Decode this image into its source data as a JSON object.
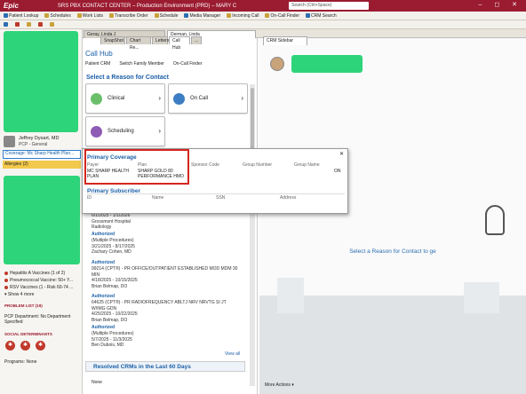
{
  "titlebar": {
    "logo": "Epic",
    "title": "SRS PBX CONTACT CENTER – Production Environment (PRD) – MARY C",
    "search_placeholder": "Search (Ctrl+Space)",
    "window_controls": "– ◻ ✕"
  },
  "toolbar": {
    "row1": [
      "Patient Lookup",
      "Schedules",
      "Work Lists",
      "Transcribe Order",
      "Schedule",
      "Media Manager",
      "Incoming Call",
      "On-Call Finder",
      "CRM Search"
    ]
  },
  "tabs": {
    "workspace": [
      "Geray, Linda J",
      "Derman, Linda"
    ],
    "activity": [
      "SnapShot",
      "Chart Re...",
      "Letters",
      "Call Hub",
      "..."
    ]
  },
  "sidebar": {
    "provider_name": "Jeffrey Dysart, MD",
    "provider_role": "PCP - General",
    "coverage": "Coverage: Mc Sharp Health Plan...",
    "allergies": "Allergies (2)",
    "vaccines": [
      "Hepatitis A Vaccines (1 of 2)",
      "Pneumococcal Vaccine: 50+ Y...",
      "RSV Vaccines (1 - Risk 60-74 ..."
    ],
    "show_more": "Show 4 more",
    "problem_list": "PROBLEM LIST (19)",
    "pcp_department": "PCP Department: No Department Specified",
    "social_determinants": "SOCIAL DETERMINANTS",
    "programs": "Programs: None"
  },
  "hub": {
    "title": "Call Hub",
    "links": [
      "Patient CRM",
      "Switch Family Member",
      "On-Call Finder"
    ],
    "select_reason": "Select a Reason for Contact",
    "reasons": [
      "Clinical",
      "On Call",
      "Scheduling"
    ],
    "auth_items": [
      {
        "lines": [
          "6/1/2025 - 1/1/2026",
          "Grossmont Hospital",
          "Radiology"
        ]
      },
      {
        "status": "Authorized",
        "lines": [
          "(Multiple Procedures)",
          "3/21/2025 - 8/17/2025",
          "Zachary Cohen, MD"
        ]
      },
      {
        "status": "Authorized",
        "lines": [
          "99214 (CPT®) - PR OFFICE/OUTPATIENT ESTABLISHED MOD MDM 30",
          "MIN",
          "4/18/2025 - 10/15/2025",
          "Brian Belmap, DO"
        ]
      },
      {
        "status": "Authorized",
        "lines": [
          "64625 (CPT®) - PR RADIOFREQUENCY ABLTJ NRV NRVTG SI JT",
          "W/IMG GDN",
          "4/25/2025 - 10/22/2025",
          "Brian Belmap, DO"
        ]
      },
      {
        "status": "Authorized",
        "lines": [
          "(Multiple Procedures)",
          "5/7/2025 - 11/3/2025",
          "Ben Dubois, MD"
        ]
      }
    ],
    "view_all": "View all",
    "resolved_title": "Resolved CRMs in the Last 60 Days",
    "resolved_value": "None"
  },
  "popup": {
    "coverage_title": "Primary Coverage",
    "cov_headers": [
      "Payer",
      "Plan",
      "Sponsor Code",
      "Group Number",
      "Group Name"
    ],
    "payer": "MC SHARP HEALTH PLAN",
    "plan": "SHARP GOLD 80 PERFORMANCE HMO",
    "group_name_value": "ON",
    "subscriber_title": "Primary Subscriber",
    "sub_headers": [
      "ID",
      "Name",
      "SSN",
      "Address"
    ]
  },
  "crm": {
    "tab": "CRM Sidebar",
    "message": "Select a Reason for Contact to ge",
    "more_actions": "More Actions ▾"
  },
  "colors": {
    "epic_red": "#9b1b30",
    "link_blue": "#1b5fa8",
    "redaction_green": "#2ed47a",
    "highlight_red": "#d4261f"
  }
}
